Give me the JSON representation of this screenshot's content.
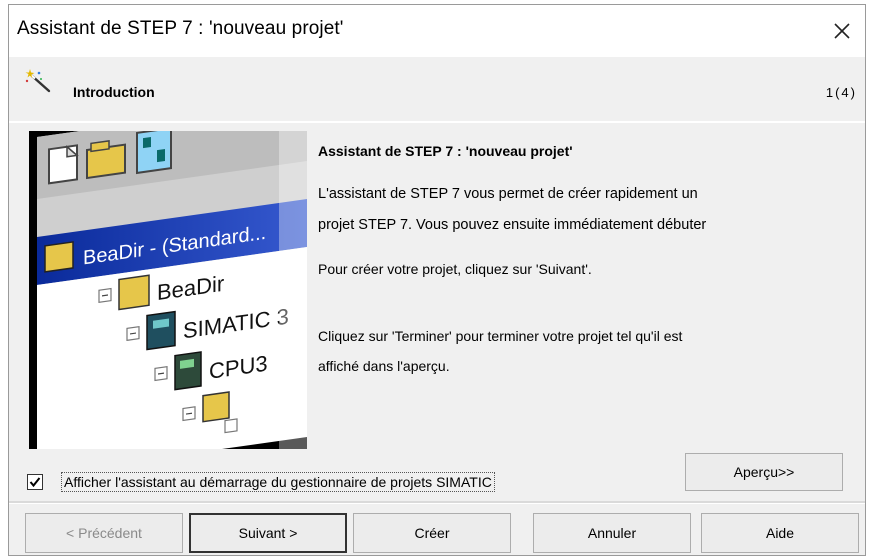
{
  "window": {
    "title": "Assistant de STEP 7 : 'nouveau projet'"
  },
  "header": {
    "step_title": "Introduction",
    "step_counter": "1(4)"
  },
  "icons": {
    "close": "close-icon",
    "wand": "wand-icon",
    "checkmark": "checkmark-icon"
  },
  "illustration": {
    "labels": [
      "BeaDir - (Standard...",
      "BeaDir",
      "SIMATIC 3",
      "CPU3"
    ]
  },
  "content": {
    "title": "Assistant de STEP 7 : 'nouveau projet'",
    "paragraph1_line1": "L'assistant de STEP 7 vous permet de créer rapidement un",
    "paragraph1_line2": "projet STEP 7. Vous pouvez ensuite immédiatement débuter",
    "paragraph2": "Pour créer votre projet, cliquez sur 'Suivant'.",
    "paragraph3_line1": "Cliquez sur 'Terminer' pour terminer votre projet tel qu'il est",
    "paragraph3_line2": "affiché dans l'aperçu."
  },
  "options": {
    "show_wizard_label": "Afficher l'assistant au démarrage du gestionnaire de projets SIMATIC",
    "show_wizard_checked": true
  },
  "buttons": {
    "apercu": "Aperçu>>",
    "precedent": "< Précédent",
    "suivant": "Suivant >",
    "creer": "Créer",
    "annuler": "Annuler",
    "aide": "Aide"
  },
  "colors": {
    "window_bg": "#f0f0f0",
    "titlebar_bg": "#ffffff",
    "illustration_bg": "#000000",
    "selection_blue": "#1a3fbf",
    "disabled_text": "#8a8a8a"
  }
}
